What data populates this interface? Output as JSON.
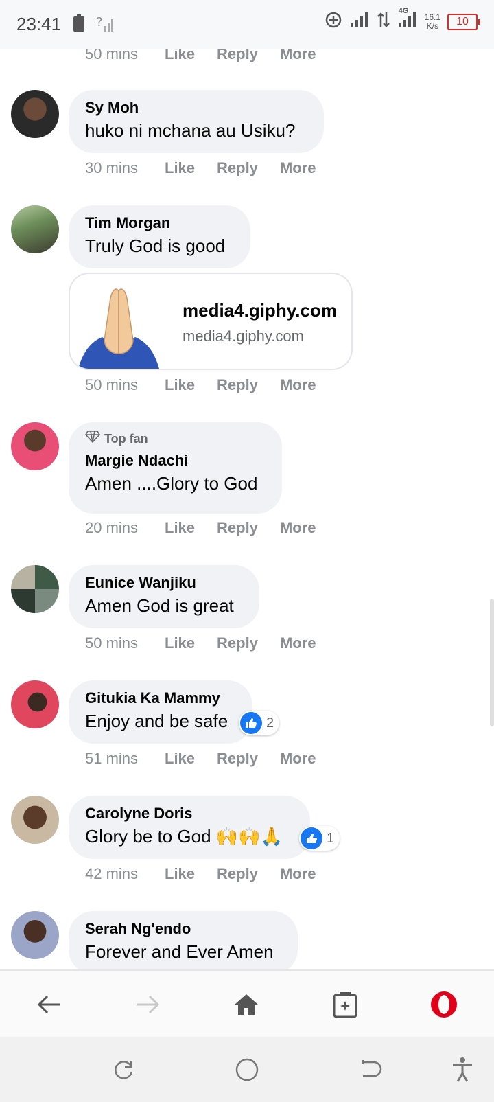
{
  "status": {
    "time": "23:41",
    "network": "4G",
    "speed_value": "16.1",
    "speed_unit": "K/s",
    "battery": "10"
  },
  "actions": {
    "like": "Like",
    "reply": "Reply",
    "more": "More"
  },
  "top_partial": {
    "time": "50 mins"
  },
  "comments": [
    {
      "author": "Sy Moh",
      "text": "huko ni mchana au Usiku?",
      "time": "30 mins"
    },
    {
      "author": "Tim Morgan",
      "text": "Truly God is good",
      "time": "50 mins",
      "link": {
        "title": "media4.giphy.com",
        "subtitle": "media4.giphy.com"
      }
    },
    {
      "badge": "Top fan",
      "author": "Margie Ndachi",
      "text": "Amen ....Glory to God",
      "time": "20 mins"
    },
    {
      "author": "Eunice Wanjiku",
      "text": "Amen God is great",
      "time": "50 mins"
    },
    {
      "author": "Gitukia Ka Mammy",
      "text": "Enjoy and be safe",
      "time": "51 mins",
      "reactions": "2"
    },
    {
      "author": "Carolyne Doris",
      "text": "Glory be to God 🙌🙌🙏",
      "time": "42 mins",
      "reactions": "1"
    },
    {
      "author": "Serah Ng'endo",
      "text": "Forever and Ever Amen"
    }
  ],
  "colors": {
    "accent": "#1877f2",
    "bubble": "#f0f2f5",
    "opera": "#e00019"
  }
}
